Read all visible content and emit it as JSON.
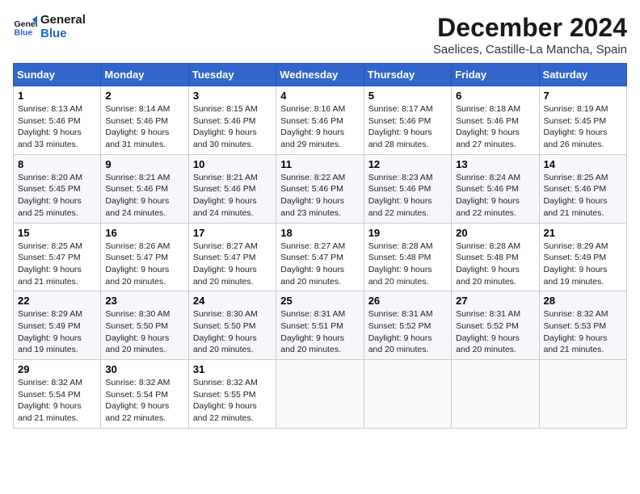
{
  "header": {
    "logo_line1": "General",
    "logo_line2": "Blue",
    "month": "December 2024",
    "location": "Saelices, Castille-La Mancha, Spain"
  },
  "weekdays": [
    "Sunday",
    "Monday",
    "Tuesday",
    "Wednesday",
    "Thursday",
    "Friday",
    "Saturday"
  ],
  "weeks": [
    [
      {
        "day": "1",
        "sunrise": "Sunrise: 8:13 AM",
        "sunset": "Sunset: 5:46 PM",
        "daylight": "Daylight: 9 hours and 33 minutes."
      },
      {
        "day": "2",
        "sunrise": "Sunrise: 8:14 AM",
        "sunset": "Sunset: 5:46 PM",
        "daylight": "Daylight: 9 hours and 31 minutes."
      },
      {
        "day": "3",
        "sunrise": "Sunrise: 8:15 AM",
        "sunset": "Sunset: 5:46 PM",
        "daylight": "Daylight: 9 hours and 30 minutes."
      },
      {
        "day": "4",
        "sunrise": "Sunrise: 8:16 AM",
        "sunset": "Sunset: 5:46 PM",
        "daylight": "Daylight: 9 hours and 29 minutes."
      },
      {
        "day": "5",
        "sunrise": "Sunrise: 8:17 AM",
        "sunset": "Sunset: 5:46 PM",
        "daylight": "Daylight: 9 hours and 28 minutes."
      },
      {
        "day": "6",
        "sunrise": "Sunrise: 8:18 AM",
        "sunset": "Sunset: 5:46 PM",
        "daylight": "Daylight: 9 hours and 27 minutes."
      },
      {
        "day": "7",
        "sunrise": "Sunrise: 8:19 AM",
        "sunset": "Sunset: 5:45 PM",
        "daylight": "Daylight: 9 hours and 26 minutes."
      }
    ],
    [
      {
        "day": "8",
        "sunrise": "Sunrise: 8:20 AM",
        "sunset": "Sunset: 5:45 PM",
        "daylight": "Daylight: 9 hours and 25 minutes."
      },
      {
        "day": "9",
        "sunrise": "Sunrise: 8:21 AM",
        "sunset": "Sunset: 5:46 PM",
        "daylight": "Daylight: 9 hours and 24 minutes."
      },
      {
        "day": "10",
        "sunrise": "Sunrise: 8:21 AM",
        "sunset": "Sunset: 5:46 PM",
        "daylight": "Daylight: 9 hours and 24 minutes."
      },
      {
        "day": "11",
        "sunrise": "Sunrise: 8:22 AM",
        "sunset": "Sunset: 5:46 PM",
        "daylight": "Daylight: 9 hours and 23 minutes."
      },
      {
        "day": "12",
        "sunrise": "Sunrise: 8:23 AM",
        "sunset": "Sunset: 5:46 PM",
        "daylight": "Daylight: 9 hours and 22 minutes."
      },
      {
        "day": "13",
        "sunrise": "Sunrise: 8:24 AM",
        "sunset": "Sunset: 5:46 PM",
        "daylight": "Daylight: 9 hours and 22 minutes."
      },
      {
        "day": "14",
        "sunrise": "Sunrise: 8:25 AM",
        "sunset": "Sunset: 5:46 PM",
        "daylight": "Daylight: 9 hours and 21 minutes."
      }
    ],
    [
      {
        "day": "15",
        "sunrise": "Sunrise: 8:25 AM",
        "sunset": "Sunset: 5:47 PM",
        "daylight": "Daylight: 9 hours and 21 minutes."
      },
      {
        "day": "16",
        "sunrise": "Sunrise: 8:26 AM",
        "sunset": "Sunset: 5:47 PM",
        "daylight": "Daylight: 9 hours and 20 minutes."
      },
      {
        "day": "17",
        "sunrise": "Sunrise: 8:27 AM",
        "sunset": "Sunset: 5:47 PM",
        "daylight": "Daylight: 9 hours and 20 minutes."
      },
      {
        "day": "18",
        "sunrise": "Sunrise: 8:27 AM",
        "sunset": "Sunset: 5:47 PM",
        "daylight": "Daylight: 9 hours and 20 minutes."
      },
      {
        "day": "19",
        "sunrise": "Sunrise: 8:28 AM",
        "sunset": "Sunset: 5:48 PM",
        "daylight": "Daylight: 9 hours and 20 minutes."
      },
      {
        "day": "20",
        "sunrise": "Sunrise: 8:28 AM",
        "sunset": "Sunset: 5:48 PM",
        "daylight": "Daylight: 9 hours and 20 minutes."
      },
      {
        "day": "21",
        "sunrise": "Sunrise: 8:29 AM",
        "sunset": "Sunset: 5:49 PM",
        "daylight": "Daylight: 9 hours and 19 minutes."
      }
    ],
    [
      {
        "day": "22",
        "sunrise": "Sunrise: 8:29 AM",
        "sunset": "Sunset: 5:49 PM",
        "daylight": "Daylight: 9 hours and 19 minutes."
      },
      {
        "day": "23",
        "sunrise": "Sunrise: 8:30 AM",
        "sunset": "Sunset: 5:50 PM",
        "daylight": "Daylight: 9 hours and 20 minutes."
      },
      {
        "day": "24",
        "sunrise": "Sunrise: 8:30 AM",
        "sunset": "Sunset: 5:50 PM",
        "daylight": "Daylight: 9 hours and 20 minutes."
      },
      {
        "day": "25",
        "sunrise": "Sunrise: 8:31 AM",
        "sunset": "Sunset: 5:51 PM",
        "daylight": "Daylight: 9 hours and 20 minutes."
      },
      {
        "day": "26",
        "sunrise": "Sunrise: 8:31 AM",
        "sunset": "Sunset: 5:52 PM",
        "daylight": "Daylight: 9 hours and 20 minutes."
      },
      {
        "day": "27",
        "sunrise": "Sunrise: 8:31 AM",
        "sunset": "Sunset: 5:52 PM",
        "daylight": "Daylight: 9 hours and 20 minutes."
      },
      {
        "day": "28",
        "sunrise": "Sunrise: 8:32 AM",
        "sunset": "Sunset: 5:53 PM",
        "daylight": "Daylight: 9 hours and 21 minutes."
      }
    ],
    [
      {
        "day": "29",
        "sunrise": "Sunrise: 8:32 AM",
        "sunset": "Sunset: 5:54 PM",
        "daylight": "Daylight: 9 hours and 21 minutes."
      },
      {
        "day": "30",
        "sunrise": "Sunrise: 8:32 AM",
        "sunset": "Sunset: 5:54 PM",
        "daylight": "Daylight: 9 hours and 22 minutes."
      },
      {
        "day": "31",
        "sunrise": "Sunrise: 8:32 AM",
        "sunset": "Sunset: 5:55 PM",
        "daylight": "Daylight: 9 hours and 22 minutes."
      },
      null,
      null,
      null,
      null
    ]
  ]
}
